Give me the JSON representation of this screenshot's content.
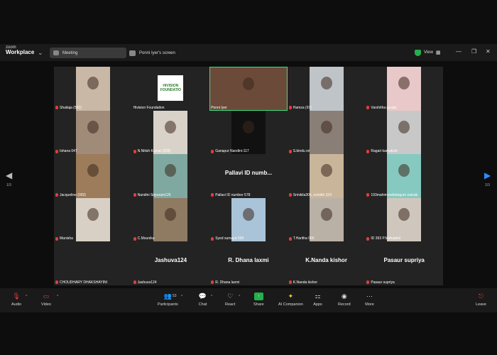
{
  "app": {
    "logo_line1": "zoom",
    "logo_line2": "Workplace"
  },
  "header": {
    "tab_meeting": "Meeting",
    "tab_share": "Ponni Iyer's screen",
    "view_label": "View"
  },
  "pagination": {
    "left": "1/3",
    "right": "1/3"
  },
  "participants": [
    {
      "name": "Shailaja (582)",
      "bg": "#c9b8a6",
      "muted": true
    },
    {
      "name": "Hivision Foundation",
      "bg": "#ffffff",
      "muted": false,
      "logo": "HIVISION FOUNDATIO"
    },
    {
      "name": "Ponni Iyer",
      "bg": "#6b4a3a",
      "muted": false,
      "active": true
    },
    {
      "name": "Hamza (97)",
      "bg": "#bfc4c8",
      "muted": true
    },
    {
      "name": "Varshitha gouda",
      "bg": "#e8c8c8",
      "muted": true
    },
    {
      "name": "Ishana 047",
      "bg": "#a08a78",
      "muted": true
    },
    {
      "name": "N.Nitish Kumar (228)",
      "bg": "#d9d2c8",
      "muted": true
    },
    {
      "name": "Ganapur Nandini-117",
      "bg": "#111111",
      "muted": true
    },
    {
      "name": "S.bindu sri",
      "bg": "#8a7f76",
      "muted": true
    },
    {
      "name": "Ragari kamakshi",
      "bg": "#c8c8c8",
      "muted": true
    },
    {
      "name": "Jacqueline (093)",
      "bg": "#9c7c5a",
      "muted": true
    },
    {
      "name": "Nandini Sripuram126",
      "bg": "#7fa8a0",
      "muted": true
    },
    {
      "name": "Pallavi ID number 578",
      "bg": "#232323",
      "muted": true,
      "big": "Pallavi ID numb..."
    },
    {
      "name": "Srinikila306, srinidhi 324",
      "bg": "#c9b59a",
      "muted": true
    },
    {
      "name": "193mahimoodebegum zainab",
      "bg": "#86c9c0",
      "muted": true
    },
    {
      "name": "Manisha",
      "bg": "#d8d0c4",
      "muted": true
    },
    {
      "name": "C.Mounika",
      "bg": "#8f7a62",
      "muted": true
    },
    {
      "name": "Syed sumaya 539",
      "bg": "#a9c4d8",
      "muted": true
    },
    {
      "name": "T.Haritha 065",
      "bg": "#b9b0a6",
      "muted": true
    },
    {
      "name": "ID 393 P.Mahadevi",
      "bg": "#cfc7bd",
      "muted": true
    },
    {
      "name": "CHOUDHARY DHAKSHAYINI",
      "bg": "#232323",
      "muted": true,
      "big": ""
    },
    {
      "name": "Jashuva124",
      "bg": "#232323",
      "muted": true,
      "big": "Jashuva124"
    },
    {
      "name": "R. Dhana laxmi",
      "bg": "#232323",
      "muted": true,
      "big": "R. Dhana laxmi"
    },
    {
      "name": "K.Nanda kishor",
      "bg": "#232323",
      "muted": true,
      "big": "K.Nanda kishor"
    },
    {
      "name": "Pasaur supriya",
      "bg": "#232323",
      "muted": true,
      "big": "Pasaur supriya"
    }
  ],
  "toolbar": {
    "audio": "Audio",
    "video": "Video",
    "participants": "Participants",
    "participants_count": "53",
    "chat": "Chat",
    "react": "React",
    "share": "Share",
    "ai": "AI Companion",
    "apps": "Apps",
    "record": "Record",
    "more": "More",
    "leave": "Leave"
  },
  "colors": {
    "accent_green": "#22b14c",
    "muted_red": "#e0403a",
    "active_border": "#3ddc84",
    "arrow_blue": "#2d8cff"
  }
}
